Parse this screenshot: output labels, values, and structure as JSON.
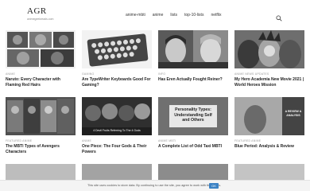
{
  "site": {
    "name": "AGR",
    "tagline": "animegeekreads.com"
  },
  "nav": [
    {
      "label": "anime-mbti"
    },
    {
      "label": "anime"
    },
    {
      "label": "lists"
    },
    {
      "label": "top-10-lists"
    },
    {
      "label": "netflix"
    }
  ],
  "icons": {
    "search": "search-icon"
  },
  "cards": [
    {
      "category": "ANIME",
      "title": "Naruto: Every Character with Flaming Red Hairs",
      "overlay": ""
    },
    {
      "category": "GAMING",
      "title": "Are TypeWriter Keyboards Good For Gaming?",
      "overlay": ""
    },
    {
      "category": "INFO",
      "title": "Has Eren Actually Fought Reiner?",
      "overlay": ""
    },
    {
      "category": "ANIME NEWS UPDATES",
      "title": "My Hero Academia New Movie 2021 | World Heroes Mission",
      "overlay": ""
    },
    {
      "category": "FEATURED ANIME",
      "title": "The MBTI Types of Avengers Characters",
      "overlay": ""
    },
    {
      "category": "ANIME",
      "title": "One Piece: The Four Gods & Their Powers",
      "overlay": "4 Devil Fruits Referring To The 4 Gods"
    },
    {
      "category": "ANIME MBTI",
      "title": "A Complete List of Odd Taxi MBTI",
      "overlay": "Personality Types: Understanding Self and Others"
    },
    {
      "category": "FEATURED ANIME",
      "title": "Blue Period: Analysis & Review",
      "overlay": "A REVIEW & ANALYSIS"
    }
  ],
  "cookie": {
    "text": "This site uses cookies to store data. By continuing to use the site, you agree to work with these files.",
    "button": "OK"
  },
  "colors": {
    "accent": "#3b82c4",
    "background": "#ffffff"
  }
}
